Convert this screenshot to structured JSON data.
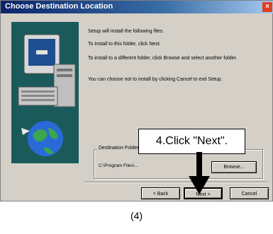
{
  "window": {
    "title": "Choose Destination Location",
    "close_glyph": "×"
  },
  "body_text": [
    "Setup will install  the following files.",
    "To install  to this folder, click Next.",
    "To install  to a different folder, click Browse and select another folder.",
    "You can choose not to install  by clicking Cancel to exit Setup."
  ],
  "destination": {
    "label": "Destination Folder",
    "path": "C:\\Program Files\\...",
    "browse_label": "Browse..."
  },
  "buttons": {
    "back": "< Back",
    "next": "Next >",
    "cancel": "Cancel"
  },
  "callout": {
    "text": "4.Click \"Next\"."
  },
  "caption": "(4)"
}
